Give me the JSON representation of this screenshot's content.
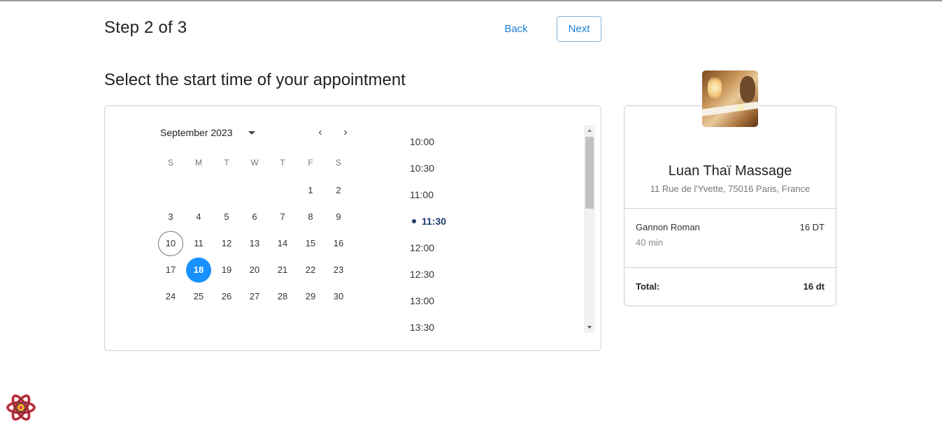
{
  "header": {
    "step_title": "Step 2 of 3",
    "back_label": "Back",
    "next_label": "Next"
  },
  "main": {
    "section_title": "Select the start time of your appointment"
  },
  "calendar": {
    "month_label": "September 2023",
    "prev_symbol": "‹",
    "next_symbol": "›",
    "weekdays": [
      "S",
      "M",
      "T",
      "W",
      "T",
      "F",
      "S"
    ],
    "days": [
      "1",
      "2",
      "3",
      "4",
      "5",
      "6",
      "7",
      "8",
      "9",
      "10",
      "11",
      "12",
      "13",
      "14",
      "15",
      "16",
      "17",
      "18",
      "19",
      "20",
      "21",
      "22",
      "23",
      "24",
      "25",
      "26",
      "27",
      "28",
      "29",
      "30"
    ],
    "first_weekday_index": 5,
    "today": "10",
    "selected": "18"
  },
  "times": {
    "slots": [
      "10:00",
      "10:30",
      "11:00",
      "11:30",
      "12:00",
      "12:30",
      "13:00",
      "13:30"
    ],
    "selected": "11:30"
  },
  "summary": {
    "salon_name": "Luan Thaï Massage",
    "address": "11 Rue de l'Yvette, 75016 Paris, France",
    "service_name": "Gannon Roman",
    "service_price": "16 DT",
    "service_duration": "40 min",
    "total_label": "Total:",
    "total_value": "16 dt"
  },
  "colors": {
    "accent": "#1890ff",
    "link": "#1c7fd6",
    "selected_time": "#1f3a6e",
    "logo": "#e8404f"
  },
  "icons": {
    "month_dropdown": "caret-down-icon",
    "prev_month": "chevron-left-icon",
    "next_month": "chevron-right-icon",
    "devtools_logo": "react-logo-icon"
  }
}
